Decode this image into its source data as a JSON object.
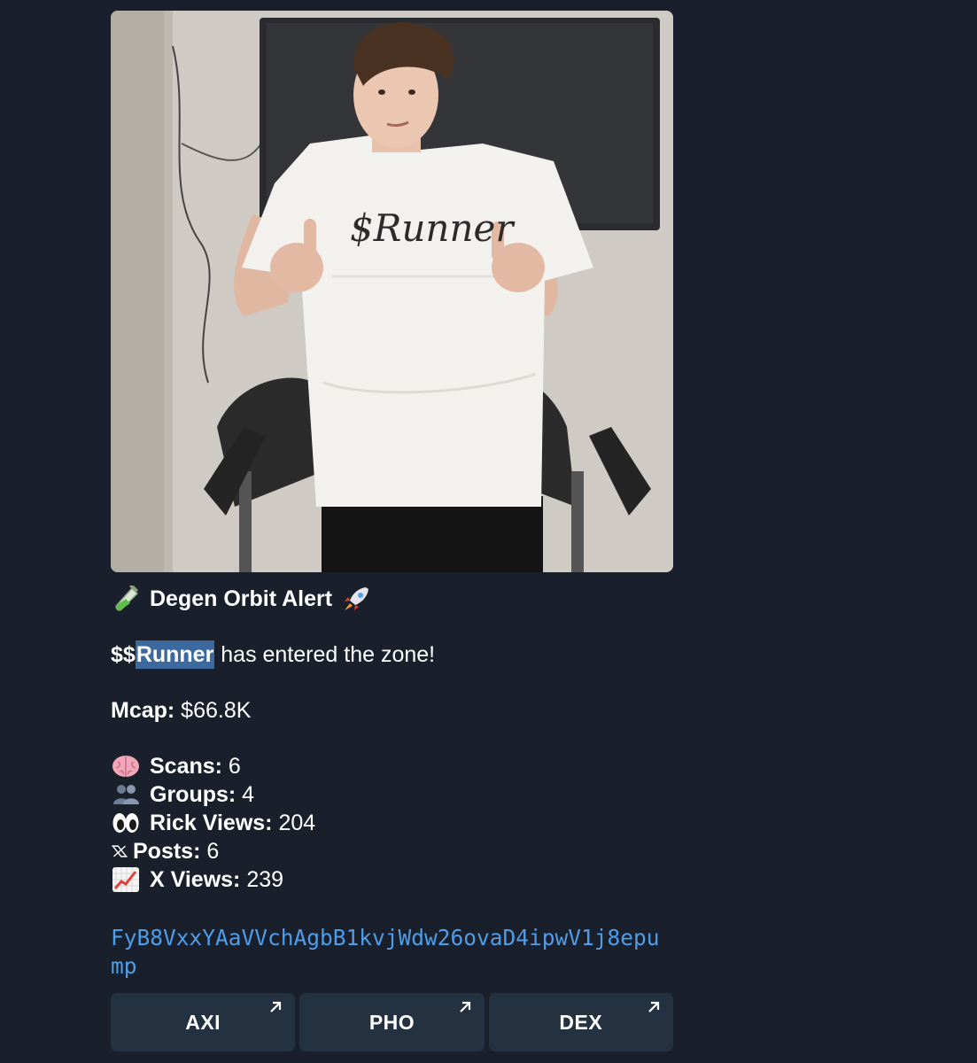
{
  "alert": {
    "title": "Degen Orbit Alert",
    "title_icon_left": "test-tube-icon",
    "title_icon_right": "rocket-icon"
  },
  "token": {
    "prefix": "$$",
    "ticker": "Runner",
    "entered_text": " has entered the zone!"
  },
  "stats": {
    "mcap_label": "Mcap:",
    "mcap_value": " $66.8K",
    "scans_label": "Scans:",
    "scans_value": " 6",
    "groups_label": "Groups:",
    "groups_value": " 4",
    "rick_views_label": "Rick Views:",
    "rick_views_value": " 204",
    "posts_label": "Posts:",
    "posts_value": " 6",
    "x_views_label": "X Views:",
    "x_views_value": " 239"
  },
  "photo": {
    "shirt_text": "$Runner"
  },
  "contract": {
    "address": "FyB8VxxYAaVVchAgbB1kvjWdw26ovaD4ipwV1j8epump"
  },
  "buttons": [
    {
      "label": "AXI",
      "icon": "external-arrow-icon"
    },
    {
      "label": "PHO",
      "icon": "external-arrow-icon"
    },
    {
      "label": "DEX",
      "icon": "external-arrow-icon"
    }
  ],
  "colors": {
    "background": "#19202b",
    "link": "#4f9de8",
    "highlight": "#3c6a9f",
    "button": "#243141"
  }
}
